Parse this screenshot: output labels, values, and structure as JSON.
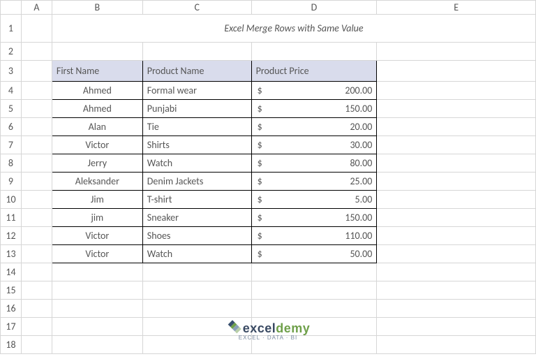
{
  "columns": [
    "A",
    "B",
    "C",
    "D",
    "E"
  ],
  "rowNumbers": [
    "1",
    "2",
    "3",
    "4",
    "5",
    "6",
    "7",
    "8",
    "9",
    "10",
    "11",
    "12",
    "13",
    "14",
    "15",
    "16",
    "17",
    "18"
  ],
  "title": "Excel Merge Rows with Same Value",
  "headers": {
    "b": "First Name",
    "c": "Product Name",
    "d": "Product Price"
  },
  "rows": [
    {
      "name": "Ahmed",
      "product": "Formal wear",
      "currency": "$",
      "amount": "200.00"
    },
    {
      "name": "Ahmed",
      "product": "Punjabi",
      "currency": "$",
      "amount": "150.00"
    },
    {
      "name": "Alan",
      "product": "Tie",
      "currency": "$",
      "amount": "20.00"
    },
    {
      "name": "Victor",
      "product": "Shirts",
      "currency": "$",
      "amount": "30.00"
    },
    {
      "name": "Jerry",
      "product": "Watch",
      "currency": "$",
      "amount": "80.00"
    },
    {
      "name": "Aleksander",
      "product": "Denim Jackets",
      "currency": "$",
      "amount": "25.00"
    },
    {
      "name": "Jim",
      "product": "T-shirt",
      "currency": "$",
      "amount": "5.00"
    },
    {
      "name": "jim",
      "product": "Sneaker",
      "currency": "$",
      "amount": "150.00"
    },
    {
      "name": "Victor",
      "product": "Shoes",
      "currency": "$",
      "amount": "110.00"
    },
    {
      "name": "Victor",
      "product": "Watch",
      "currency": "$",
      "amount": "50.00"
    }
  ],
  "logo": {
    "brand1": "excel",
    "brand2": "demy",
    "tagline": "EXCEL · DATA · BI"
  }
}
